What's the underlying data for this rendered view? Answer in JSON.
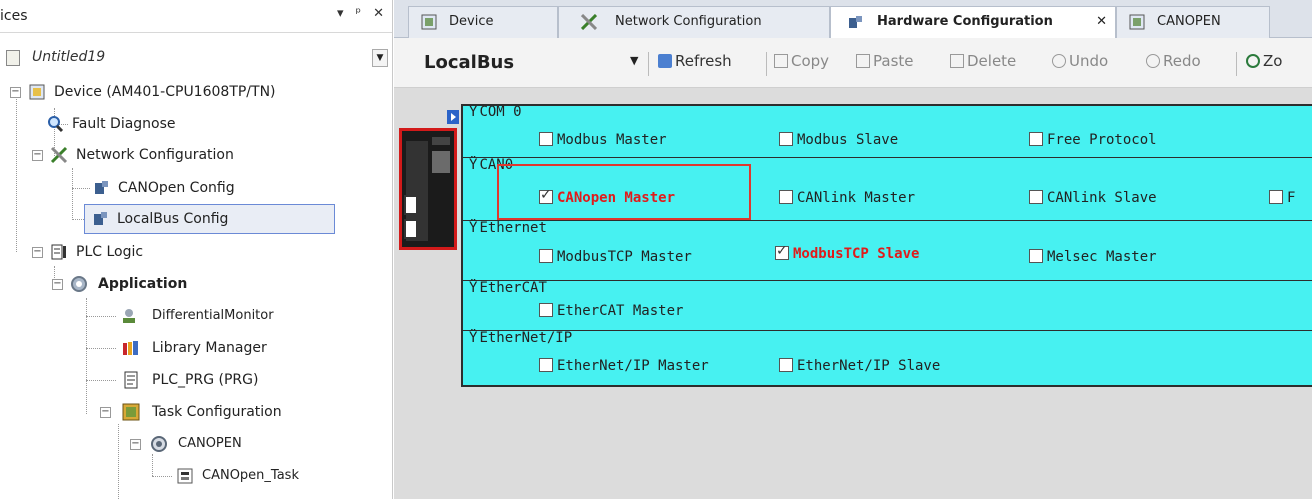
{
  "left_panel": {
    "title": "ices",
    "title_buttons": [
      "▾",
      "ᵖ",
      "✕"
    ],
    "project": {
      "name": "Untitled19",
      "dropdown": "▼"
    },
    "tree": [
      {
        "label": "Device (AM401-CPU1608TP/TN)",
        "icon": "device-icon"
      },
      {
        "label": "Fault Diagnose",
        "icon": "magnifier-icon"
      },
      {
        "label": "Network Configuration",
        "icon": "network-config-icon"
      },
      {
        "label": "CANOpen Config",
        "icon": "canopen-icon"
      },
      {
        "label": "LocalBus Config",
        "icon": "localbus-icon"
      },
      {
        "label": "PLC Logic",
        "icon": "plc-logic-icon"
      },
      {
        "label": "Application",
        "icon": "gear-icon"
      },
      {
        "label": "DifferentialMonitor",
        "icon": "monitor-icon"
      },
      {
        "label": "Library Manager",
        "icon": "library-icon"
      },
      {
        "label": "PLC_PRG (PRG)",
        "icon": "program-icon"
      },
      {
        "label": "Task Configuration",
        "icon": "task-config-icon"
      },
      {
        "label": "CANOPEN",
        "icon": "canopen-task-icon"
      },
      {
        "label": "CANOpen_Task",
        "icon": "task-icon"
      }
    ]
  },
  "tabs": [
    {
      "label": "Device",
      "icon": "device-icon"
    },
    {
      "label": "Network Configuration",
      "icon": "network-config-icon"
    },
    {
      "label": "Hardware Configuration",
      "icon": "hardware-icon",
      "close": "✕"
    },
    {
      "label": "CANOPEN",
      "icon": "device-icon"
    }
  ],
  "toolbar": {
    "title": "LocalBus",
    "dropdown": "▼",
    "buttons": [
      "Refresh",
      "Copy",
      "Paste",
      "Delete",
      "Undo",
      "Redo",
      "Zo"
    ]
  },
  "config": {
    "sections": [
      {
        "name": "COM 0"
      },
      {
        "name": "CAN0"
      },
      {
        "name": "Ethernet"
      },
      {
        "name": "EtherCAT"
      },
      {
        "name": "EtherNet/IP"
      }
    ],
    "options": [
      {
        "label": "Modbus Master",
        "checked": false
      },
      {
        "label": "Modbus Slave",
        "checked": false
      },
      {
        "label": "Free Protocol",
        "checked": false
      },
      {
        "label": "CANopen Master",
        "checked": true,
        "highlight": true
      },
      {
        "label": "CANlink Master",
        "checked": false
      },
      {
        "label": "CANlink Slave",
        "checked": false
      },
      {
        "label": "F",
        "checked": false
      },
      {
        "label": "ModbusTCP Master",
        "checked": false
      },
      {
        "label": "ModbusTCP Slave",
        "checked": true,
        "highlight": true
      },
      {
        "label": "Melsec Master",
        "checked": false
      },
      {
        "label": "EtherCAT Master",
        "checked": false
      },
      {
        "label": "EtherNet/IP Master",
        "checked": false
      },
      {
        "label": "EtherNet/IP Slave",
        "checked": false
      }
    ],
    "highlight_color": "#e01b1b",
    "panel_color": "#47f1f1"
  }
}
